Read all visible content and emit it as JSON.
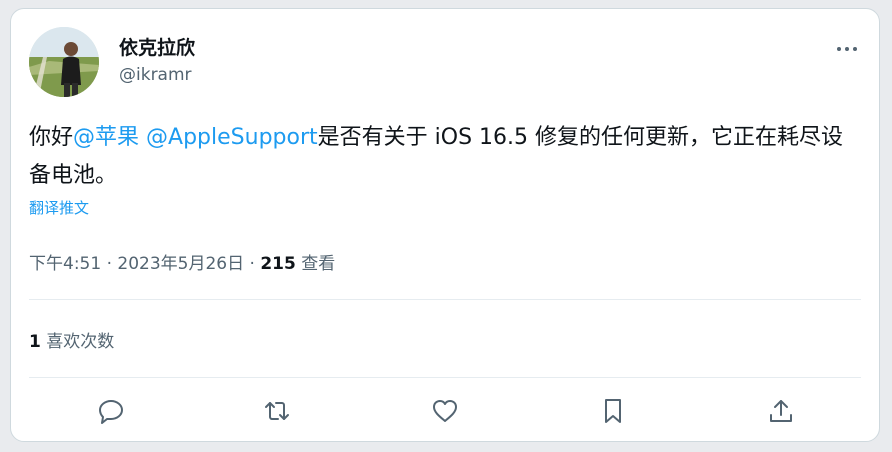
{
  "author": {
    "display_name": "依克拉欣",
    "handle": "@ikramr"
  },
  "tweet": {
    "text_prefix": "你好",
    "mention_1": "@苹果",
    "mention_2": "@AppleSupport",
    "text_rest": "是否有关于 iOS 16.5 修复的任何更新，它正在耗尽设备电池。",
    "translate_label": "翻译推文"
  },
  "meta": {
    "time": "下午4:51",
    "separator": " · ",
    "date": "2023年5月26日",
    "views_count": "215",
    "views_label": "查看"
  },
  "stats": {
    "likes_count": "1",
    "likes_label": "喜欢次数"
  },
  "icons": {
    "more": "more-dots-icon",
    "reply": "reply-icon",
    "retweet": "retweet-icon",
    "like": "like-icon",
    "bookmark": "bookmark-icon",
    "share": "share-icon"
  },
  "colors": {
    "accent": "#1d9bf0",
    "text_primary": "#0f1419",
    "text_secondary": "#536471"
  }
}
